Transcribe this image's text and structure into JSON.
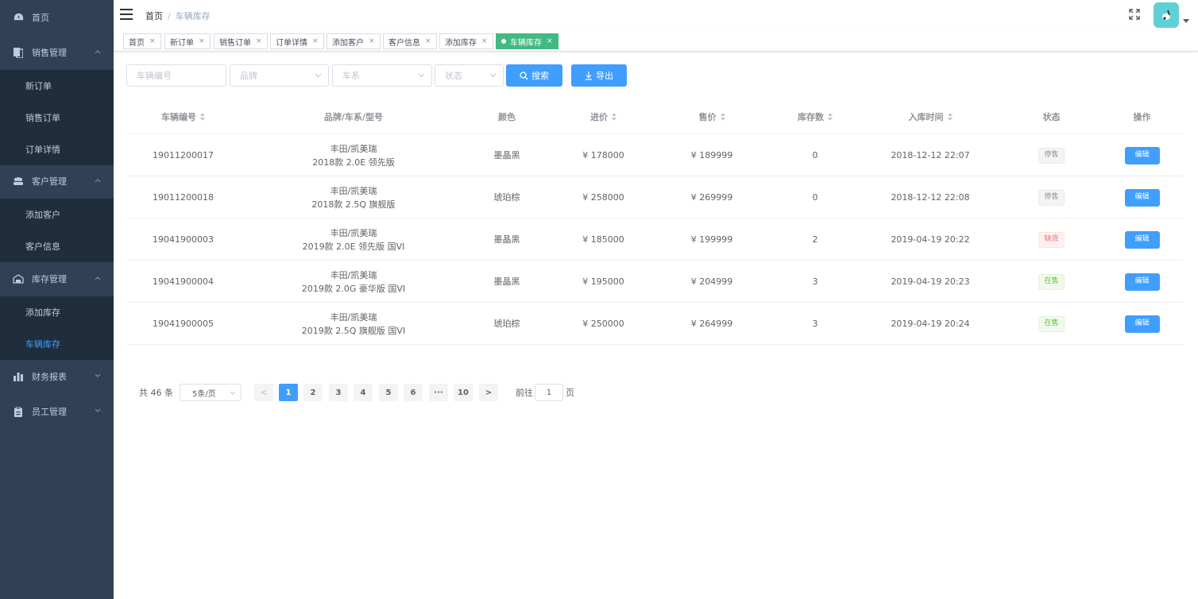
{
  "sidebar": {
    "home": "首页",
    "sales": {
      "label": "销售管理",
      "items": [
        "新订单",
        "销售订单",
        "订单详情"
      ]
    },
    "customer": {
      "label": "客户管理",
      "items": [
        "添加客户",
        "客户信息"
      ]
    },
    "inventory": {
      "label": "库存管理",
      "items": [
        "添加库存",
        "车辆库存"
      ]
    },
    "finance": "财务报表",
    "staff": "员工管理"
  },
  "breadcrumb": {
    "home": "首页",
    "sep": "/",
    "current": "车辆库存"
  },
  "tags": [
    {
      "label": "首页",
      "close": "×"
    },
    {
      "label": "新订单",
      "close": "×"
    },
    {
      "label": "销售订单",
      "close": "×"
    },
    {
      "label": "订单详情",
      "close": "×"
    },
    {
      "label": "添加客户",
      "close": "×"
    },
    {
      "label": "客户信息",
      "close": "×"
    },
    {
      "label": "添加库存",
      "close": "×"
    },
    {
      "label": "车辆库存",
      "close": "×"
    }
  ],
  "filters": {
    "vehicle_no_placeholder": "车辆编号",
    "brand_placeholder": "品牌",
    "series_placeholder": "车系",
    "status_placeholder": "状态",
    "search_label": "搜索",
    "export_label": "导出"
  },
  "table": {
    "headers": [
      "车辆编号",
      "品牌/车系/型号",
      "颜色",
      "进价",
      "售价",
      "库存数",
      "入库时间",
      "状态",
      "操作"
    ],
    "rows": [
      {
        "id": "19011200017",
        "model1": "丰田/凯美瑞",
        "model2": "2018款 2.0E 领先版",
        "color": "墨晶黑",
        "cost": "¥ 178000",
        "price": "¥ 189999",
        "stock": "0",
        "time": "2018-12-12 22:07",
        "status": "停售",
        "action": "编辑"
      },
      {
        "id": "19011200018",
        "model1": "丰田/凯美瑞",
        "model2": "2018款 2.5Q 旗舰版",
        "color": "琥珀棕",
        "cost": "¥ 258000",
        "price": "¥ 269999",
        "stock": "0",
        "time": "2018-12-12 22:08",
        "status": "停售",
        "action": "编辑"
      },
      {
        "id": "19041900003",
        "model1": "丰田/凯美瑞",
        "model2": "2019款 2.0E 领先版 国VI",
        "color": "墨晶黑",
        "cost": "¥ 185000",
        "price": "¥ 199999",
        "stock": "2",
        "time": "2019-04-19 20:22",
        "status": "缺货",
        "action": "编辑"
      },
      {
        "id": "19041900004",
        "model1": "丰田/凯美瑞",
        "model2": "2019款 2.0G 豪华版 国VI",
        "color": "墨晶黑",
        "cost": "¥ 195000",
        "price": "¥ 204999",
        "stock": "3",
        "time": "2019-04-19 20:23",
        "status": "在售",
        "action": "编辑"
      },
      {
        "id": "19041900005",
        "model1": "丰田/凯美瑞",
        "model2": "2019款 2.5Q 旗舰版 国VI",
        "color": "琥珀棕",
        "cost": "¥ 250000",
        "price": "¥ 264999",
        "stock": "3",
        "time": "2019-04-19 20:24",
        "status": "在售",
        "action": "编辑"
      }
    ]
  },
  "pagination": {
    "total": "共 46 条",
    "page_size": "5条/页",
    "prev": "<",
    "pages": [
      "1",
      "2",
      "3",
      "4",
      "5",
      "6",
      "···",
      "10"
    ],
    "next": ">",
    "goto": "前往",
    "current": "1",
    "page_unit": "页"
  },
  "colors": {
    "sidebar_bg": "#304156",
    "primary": "#409eff",
    "active_tag": "#42b983"
  }
}
